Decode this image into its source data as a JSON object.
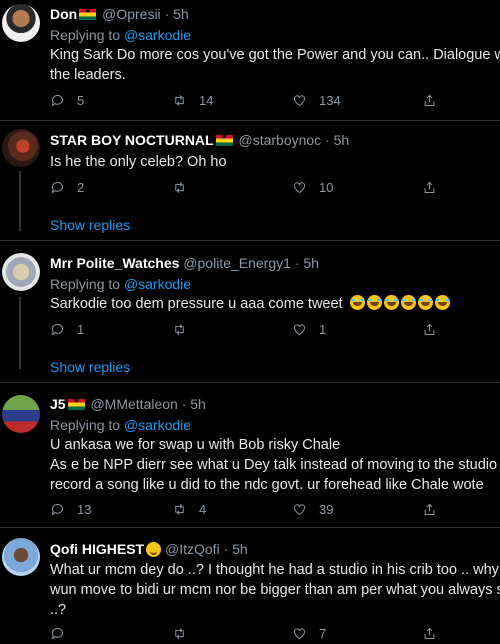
{
  "tweets": [
    {
      "name": "Don",
      "handle": "@Opresii",
      "time": "· 5h",
      "reply_prefix": "Replying to",
      "reply_to": "@sarkodie",
      "lines": [
        "King Sark Do more cos you've got the Power and you can.. Dialogue with",
        "the leaders."
      ],
      "replies": "5",
      "retweets": "14",
      "likes": "134"
    },
    {
      "name": "STAR BOY NOCTURNAL",
      "handle": "@starboynoc",
      "time": "· 5h",
      "lines": [
        "Is he the only celeb? Oh ho"
      ],
      "replies": "2",
      "retweets": "",
      "likes": "10",
      "show_replies": "Show replies"
    },
    {
      "name": "Mrr Polite_Watches",
      "handle": "@polite_Energy1",
      "time": "· 5h",
      "reply_prefix": "Replying to",
      "reply_to": "@sarkodie",
      "lines": [
        "Sarkodie too dem pressure u aaa come tweet"
      ],
      "replies": "1",
      "retweets": "",
      "likes": "1",
      "show_replies": "Show replies"
    },
    {
      "name": "J5",
      "handle": "@MMettaleon",
      "time": "· 5h",
      "reply_prefix": "Replying to",
      "reply_to": "@sarkodie",
      "lines": [
        "U ankasa we for swap u with Bob risky Chale",
        "As e be NPP dierr see what u Dey talk instead of moving to the studio to",
        "record a song like u did to the ndc govt. ur forehead like Chale wote"
      ],
      "replies": "13",
      "retweets": "4",
      "likes": "39"
    },
    {
      "name": "Qofi HIGHEST",
      "handle": "@ItzQofi",
      "time": "· 5h",
      "lines": [
        "What ur mcm dey do ..? I thought he had a studio in his crib too .. why ya",
        "wun move to bidi ur mcm nor be bigger than am per what you always say",
        "..?"
      ],
      "replies": "",
      "retweets": "",
      "likes": "7"
    }
  ]
}
